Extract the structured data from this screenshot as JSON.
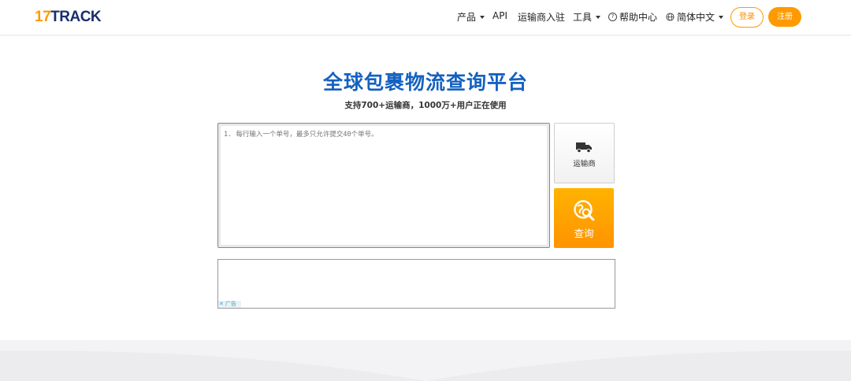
{
  "header": {
    "logo_num": "17",
    "logo_text": "TRACK",
    "nav": {
      "products": "产品",
      "api": "API",
      "carrier_join": "运输商入驻",
      "tools": "工具",
      "help": "帮助中心",
      "language": "简体中文"
    },
    "login": "登录",
    "register": "注册"
  },
  "hero": {
    "title": "全球包裹物流查询平台",
    "subtitle": "支持700+运输商，1000万+用户正在使用"
  },
  "tracking": {
    "placeholder": "1. 每行输入一个单号，最多只允许提交40个单号。",
    "carrier_label": "运输商",
    "query_label": "查询"
  },
  "ad": {
    "badge": "广告"
  },
  "colors": {
    "brand_orange": "#ff9a00",
    "brand_blue": "#1461c0"
  },
  "icons": [
    "truck-icon",
    "globe-search-icon",
    "help-circle-icon",
    "globe-icon",
    "caret-down-icon",
    "close-icon"
  ]
}
